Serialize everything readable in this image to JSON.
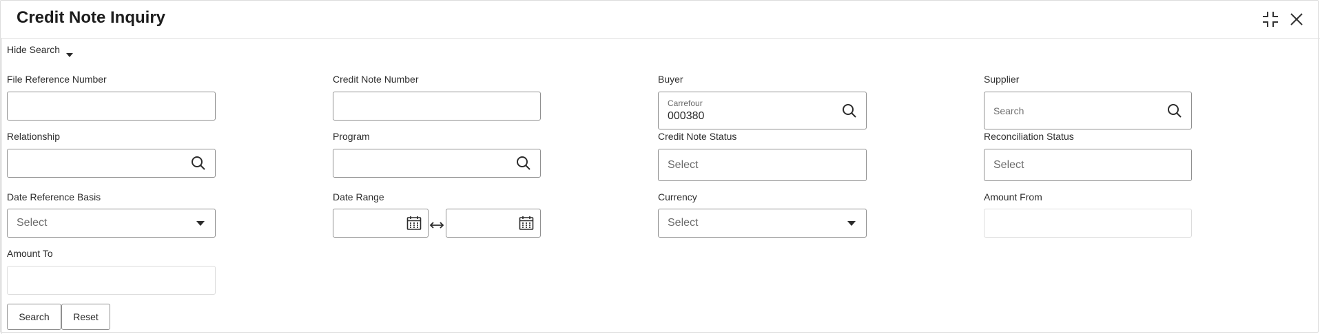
{
  "title": "Credit Note Inquiry",
  "header": {
    "expand_icon": "collapse-arrows-icon",
    "close_icon": "close-icon"
  },
  "toggle": {
    "label": "Hide Search",
    "icon": "caret-down-icon"
  },
  "fields": {
    "file_reference_number": {
      "label": "File Reference Number",
      "value": ""
    },
    "credit_note_number": {
      "label": "Credit Note Number",
      "value": ""
    },
    "buyer": {
      "label": "Buyer",
      "name": "Carrefour",
      "value": "000380",
      "icon": "search-icon"
    },
    "supplier": {
      "label": "Supplier",
      "placeholder": "Search",
      "icon": "search-icon"
    },
    "relationship": {
      "label": "Relationship",
      "value": "",
      "icon": "search-icon"
    },
    "program": {
      "label": "Program",
      "value": "",
      "icon": "search-icon"
    },
    "credit_note_status": {
      "label": "Credit Note Status",
      "placeholder": "Select"
    },
    "reconciliation_status": {
      "label": "Reconciliation Status",
      "placeholder": "Select"
    },
    "date_reference_basis": {
      "label": "Date Reference Basis",
      "placeholder": "Select",
      "icon": "chevron-down-icon"
    },
    "date_range": {
      "label": "Date Range",
      "from": "",
      "to": "",
      "icon": "calendar-icon",
      "separator_icon": "left-right-arrow-icon"
    },
    "currency": {
      "label": "Currency",
      "placeholder": "Select",
      "icon": "chevron-down-icon"
    },
    "amount_from": {
      "label": "Amount From",
      "value": ""
    },
    "amount_to": {
      "label": "Amount To",
      "value": ""
    }
  },
  "buttons": {
    "search": "Search",
    "reset": "Reset"
  }
}
